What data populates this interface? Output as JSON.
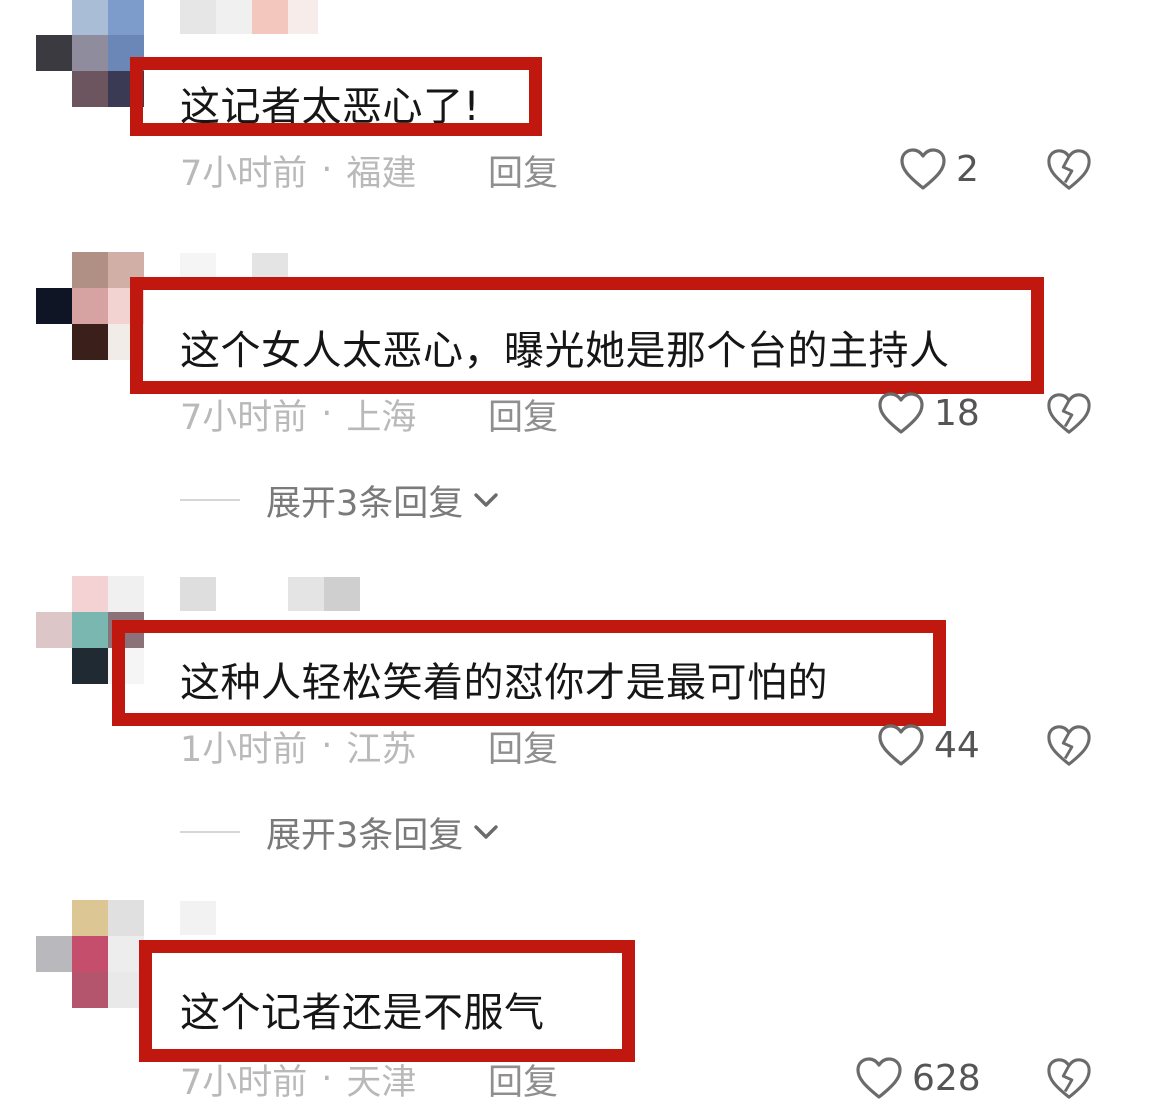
{
  "comments": [
    {
      "text": "这记者太恶心了!",
      "time": "7小时前",
      "location": "福建",
      "reply_label": "回复",
      "likes": "2"
    },
    {
      "text": "这个女人太恶心，曝光她是那个台的主持人",
      "time": "7小时前",
      "location": "上海",
      "reply_label": "回复",
      "likes": "18",
      "expand_label": "展开3条回复"
    },
    {
      "text": "这种人轻松笑着的怼你才是最可怕的",
      "time": "1小时前",
      "location": "江苏",
      "reply_label": "回复",
      "likes": "44",
      "expand_label": "展开3条回复"
    },
    {
      "text": "这个记者还是不服气",
      "time": "7小时前",
      "location": "天津",
      "reply_label": "回复",
      "likes": "628"
    }
  ],
  "separator": "·",
  "colors": {
    "highlight": "#c0170f",
    "meta_text": "#b9b9b9",
    "icon": "#6b6b6b"
  },
  "icons": {
    "like": "heart-outline-icon",
    "dislike": "broken-heart-icon",
    "expand": "chevron-down-icon"
  }
}
